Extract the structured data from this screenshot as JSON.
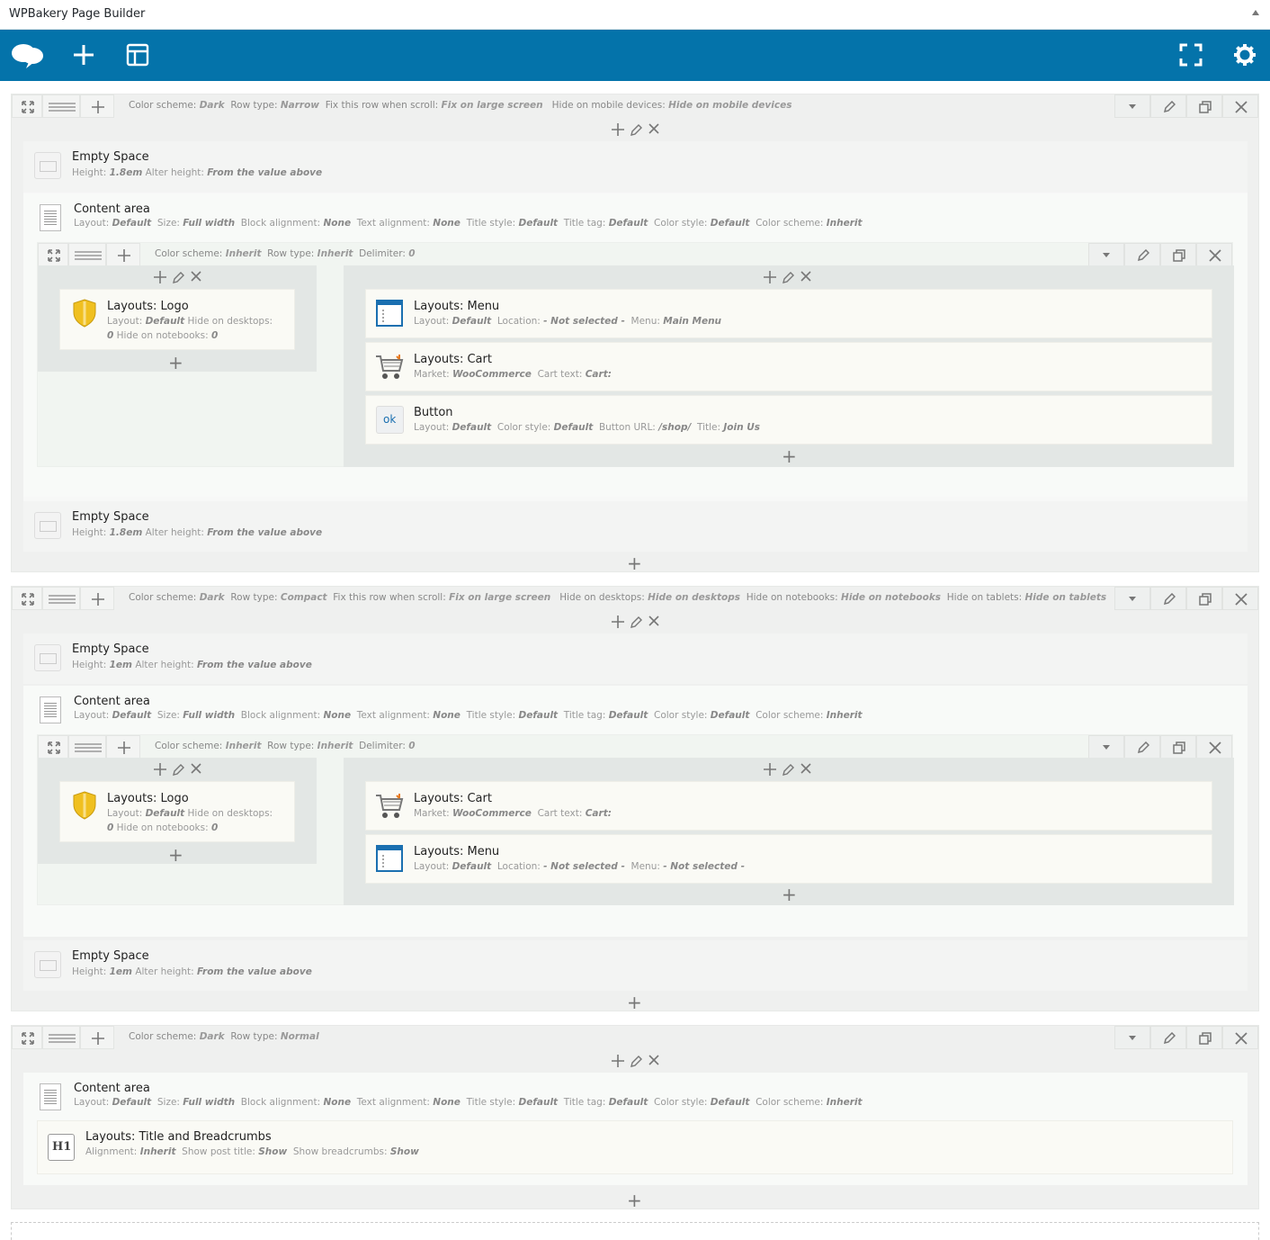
{
  "app": {
    "title": "WPBakery Page Builder"
  },
  "rows": [
    {
      "header": [
        {
          "k": "Color scheme:",
          "v": "Dark"
        },
        {
          "k": "Row type:",
          "v": "Narrow"
        },
        {
          "k": "Fix this row when scroll:",
          "v": "Fix on large screen"
        },
        {
          "k": "Hide on mobile devices:",
          "v": "Hide on mobile devices"
        }
      ]
    },
    {
      "header": [
        {
          "k": "Color scheme:",
          "v": "Dark"
        },
        {
          "k": "Row type:",
          "v": "Compact"
        },
        {
          "k": "Fix this row when scroll:",
          "v": "Fix on large screen"
        },
        {
          "k": "Hide on desktops:",
          "v": "Hide on desktops"
        },
        {
          "k": "Hide on notebooks:",
          "v": "Hide on notebooks"
        },
        {
          "k": "Hide on tablets:",
          "v": "Hide on tablets"
        }
      ]
    },
    {
      "header": [
        {
          "k": "Color scheme:",
          "v": "Dark"
        },
        {
          "k": "Row type:",
          "v": "Normal"
        }
      ]
    }
  ],
  "inner_header": [
    {
      "k": "Color scheme:",
      "v": "Inherit"
    },
    {
      "k": "Row type:",
      "v": "Inherit"
    },
    {
      "k": "Delimiter:",
      "v": "0"
    }
  ],
  "elements": {
    "empty_space": {
      "name": "Empty Space",
      "params_a": [
        {
          "k": "Height:",
          "v": "1.8em"
        },
        {
          "k": "Alter height:",
          "v": "From the value above"
        }
      ],
      "params_b": [
        {
          "k": "Height:",
          "v": "1em"
        },
        {
          "k": "Alter height:",
          "v": "From the value above"
        }
      ]
    },
    "content_area": {
      "name": "Content area",
      "params": [
        {
          "k": "Layout:",
          "v": "Default"
        },
        {
          "k": "Size:",
          "v": "Full width"
        },
        {
          "k": "Block alignment:",
          "v": "None"
        },
        {
          "k": "Text alignment:",
          "v": "None"
        },
        {
          "k": "Title style:",
          "v": "Default"
        },
        {
          "k": "Title tag:",
          "v": "Default"
        },
        {
          "k": "Color style:",
          "v": "Default"
        },
        {
          "k": "Color scheme:",
          "v": "Inherit"
        }
      ]
    },
    "logo": {
      "name": "Layouts: Logo",
      "line1": [
        {
          "k": "Layout:",
          "v": "Default"
        },
        {
          "k": "Hide on desktops:",
          "v": ""
        }
      ],
      "line2": [
        {
          "k": "",
          "v": "0"
        },
        {
          "k": "Hide on notebooks:",
          "v": "0"
        }
      ]
    },
    "menu_a": {
      "name": "Layouts: Menu",
      "params": [
        {
          "k": "Layout:",
          "v": "Default"
        },
        {
          "k": "Location:",
          "v": "- Not selected -"
        },
        {
          "k": "Menu:",
          "v": "Main Menu"
        }
      ]
    },
    "menu_b": {
      "name": "Layouts: Menu",
      "params": [
        {
          "k": "Layout:",
          "v": "Default"
        },
        {
          "k": "Location:",
          "v": "- Not selected -"
        },
        {
          "k": "Menu:",
          "v": "- Not selected -"
        }
      ]
    },
    "cart": {
      "name": "Layouts: Cart",
      "params": [
        {
          "k": "Market:",
          "v": "WooCommerce"
        },
        {
          "k": "Cart text:",
          "v": "Cart:"
        }
      ]
    },
    "button": {
      "name": "Button",
      "icon_text": "ok",
      "params": [
        {
          "k": "Layout:",
          "v": "Default"
        },
        {
          "k": "Color style:",
          "v": "Default"
        },
        {
          "k": "Button URL:",
          "v": "/shop/"
        },
        {
          "k": "Title:",
          "v": "Join Us"
        }
      ]
    },
    "title": {
      "name": "Layouts: Title and Breadcrumbs",
      "icon_text": "H1",
      "params": [
        {
          "k": "Alignment:",
          "v": "Inherit"
        },
        {
          "k": "Show post title:",
          "v": "Show"
        },
        {
          "k": "Show breadcrumbs:",
          "v": "Show"
        }
      ]
    }
  }
}
